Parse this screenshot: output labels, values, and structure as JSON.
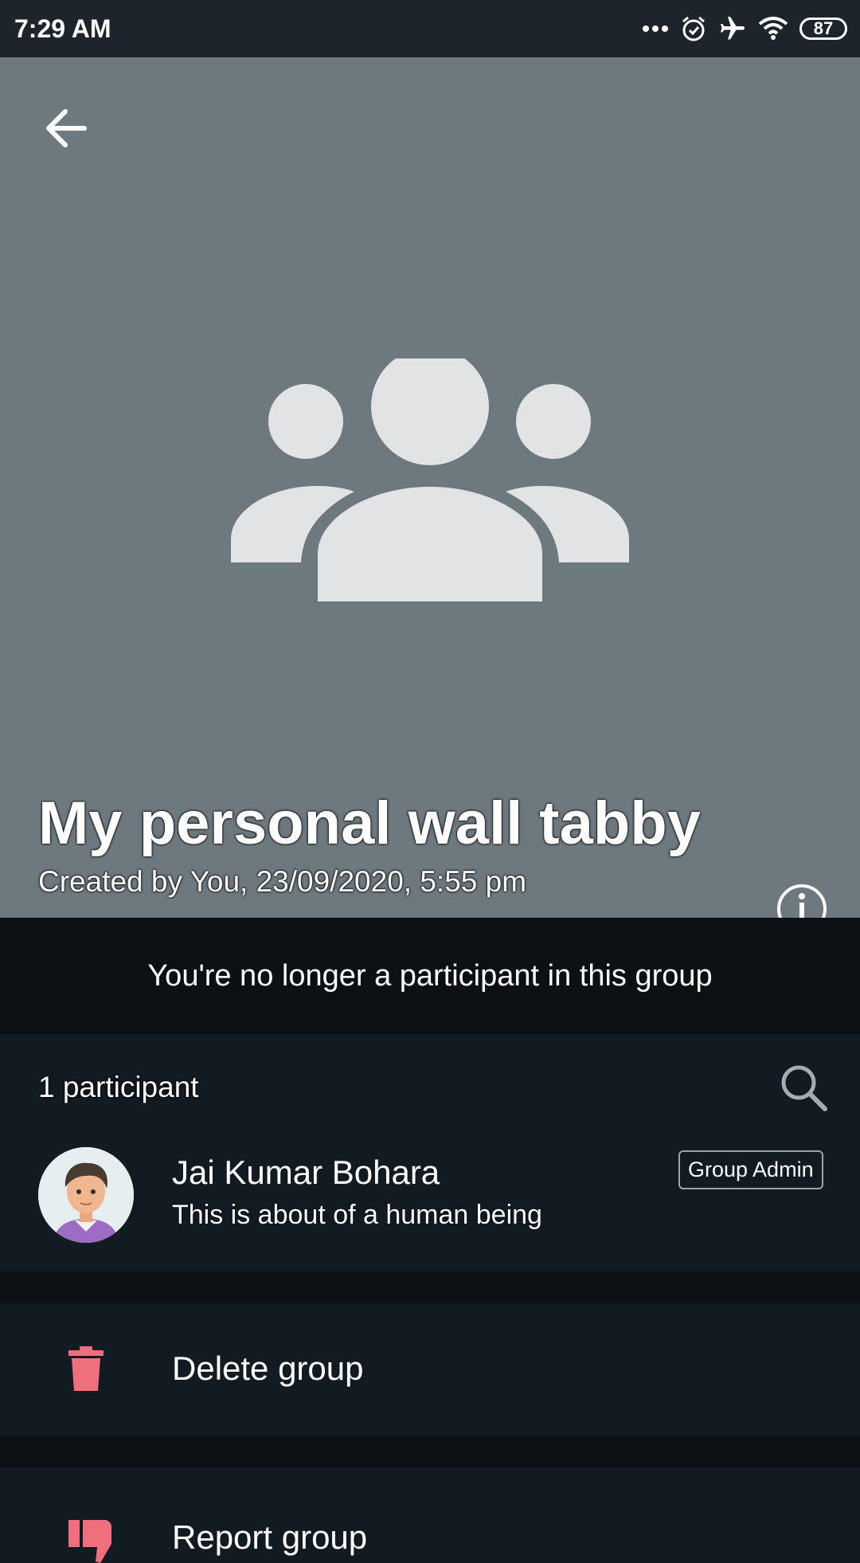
{
  "status_bar": {
    "time": "7:29 AM",
    "battery": "87",
    "icons": [
      "more-dots-icon",
      "alarm-icon",
      "airplane-icon",
      "wifi-icon",
      "battery-icon"
    ]
  },
  "header": {
    "back_icon": "arrow-left-icon",
    "avatar_icon": "group-icon",
    "title": "My personal wall tabby",
    "subtitle": "Created by You, 23/09/2020, 5:55 pm",
    "info_icon": "info-icon",
    "background": "#6d797e"
  },
  "notice": {
    "text": "You're no longer a participant in this group"
  },
  "participants": {
    "count_label": "1 participant",
    "search_icon": "search-icon",
    "members": [
      {
        "name": "Jai Kumar Bohara",
        "status": "This is about of a human being",
        "badge": "Group Admin"
      }
    ]
  },
  "actions": {
    "delete_label": "Delete group",
    "delete_icon": "trash-icon",
    "report_label": "Report group",
    "report_icon": "thumbs-down-icon",
    "danger_color": "#ef6f7d"
  }
}
